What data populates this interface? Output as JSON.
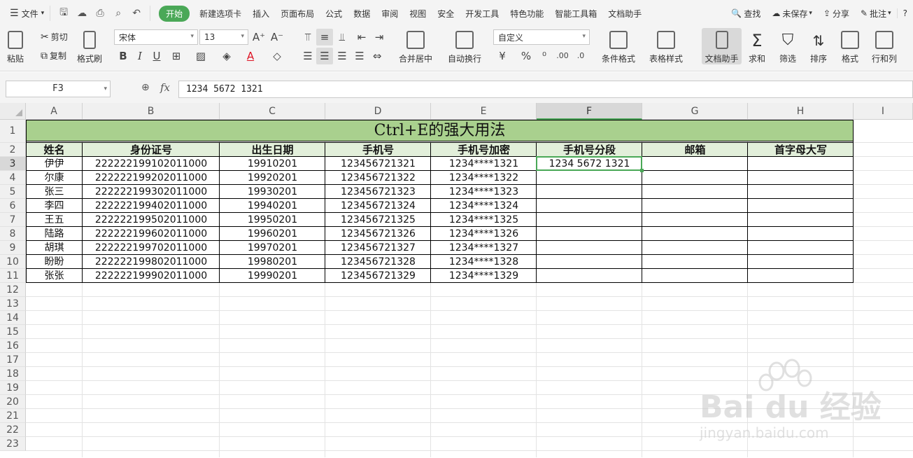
{
  "menubar": {
    "file": "文件",
    "tabs": [
      "开始",
      "新建选项卡",
      "插入",
      "页面布局",
      "公式",
      "数据",
      "审阅",
      "视图",
      "安全",
      "开发工具",
      "特色功能",
      "智能工具箱",
      "文档助手"
    ],
    "active_tab": "开始",
    "search": "查找",
    "unsaved": "未保存",
    "share": "分享",
    "comment": "批注",
    "help": "?"
  },
  "ribbon": {
    "paste": "粘贴",
    "cut": "剪切",
    "copy": "复制",
    "format_painter": "格式刷",
    "font_name": "宋体",
    "font_size": "13",
    "merge_center": "合并居中",
    "wrap_text": "自动换行",
    "number_format": "自定义",
    "conditional_format": "条件格式",
    "table_style": "表格样式",
    "doc_helper": "文档助手",
    "sum": "求和",
    "filter": "筛选",
    "sort": "排序",
    "format": "格式",
    "rows_cols": "行和列"
  },
  "formula_bar": {
    "cell_ref": "F3",
    "fx": "fx",
    "value": "1234 5672 1321"
  },
  "sheet": {
    "columns": [
      "A",
      "B",
      "C",
      "D",
      "E",
      "F",
      "G",
      "H",
      "I"
    ],
    "active_col": "F",
    "rows": [
      "1",
      "2",
      "3",
      "4",
      "5",
      "6",
      "7",
      "8",
      "9",
      "10",
      "11",
      "12",
      "13",
      "14",
      "15",
      "16",
      "17",
      "18",
      "19",
      "20",
      "21",
      "22",
      "23"
    ],
    "active_row": "3",
    "title": "Ctrl+E的强大用法",
    "headers": [
      "姓名",
      "身份证号",
      "出生日期",
      "手机号",
      "手机号加密",
      "手机号分段",
      "邮箱",
      "首字母大写"
    ],
    "records": [
      [
        "伊伊",
        "222222199102011000",
        "19910201",
        "123456721321",
        "1234****1321",
        "1234 5672 1321",
        "",
        ""
      ],
      [
        "尔康",
        "222222199202011000",
        "19920201",
        "123456721322",
        "1234****1322",
        "",
        "",
        ""
      ],
      [
        "张三",
        "222222199302011000",
        "19930201",
        "123456721323",
        "1234****1323",
        "",
        "",
        ""
      ],
      [
        "李四",
        "222222199402011000",
        "19940201",
        "123456721324",
        "1234****1324",
        "",
        "",
        ""
      ],
      [
        "王五",
        "222222199502011000",
        "19950201",
        "123456721325",
        "1234****1325",
        "",
        "",
        ""
      ],
      [
        "陆路",
        "222222199602011000",
        "19960201",
        "123456721326",
        "1234****1326",
        "",
        "",
        ""
      ],
      [
        "胡琪",
        "222222199702011000",
        "19970201",
        "123456721327",
        "1234****1327",
        "",
        "",
        ""
      ],
      [
        "盼盼",
        "222222199802011000",
        "19980201",
        "123456721328",
        "1234****1328",
        "",
        "",
        ""
      ],
      [
        "张张",
        "222222199902011000",
        "19990201",
        "123456721329",
        "1234****1329",
        "",
        "",
        ""
      ]
    ]
  },
  "watermark": {
    "brand": "Bai du 经验",
    "url": "jingyan.baidu.com"
  },
  "colors": {
    "accent": "#4aa857",
    "title_fill": "#a9d08e",
    "header_fill": "#e2efda"
  }
}
